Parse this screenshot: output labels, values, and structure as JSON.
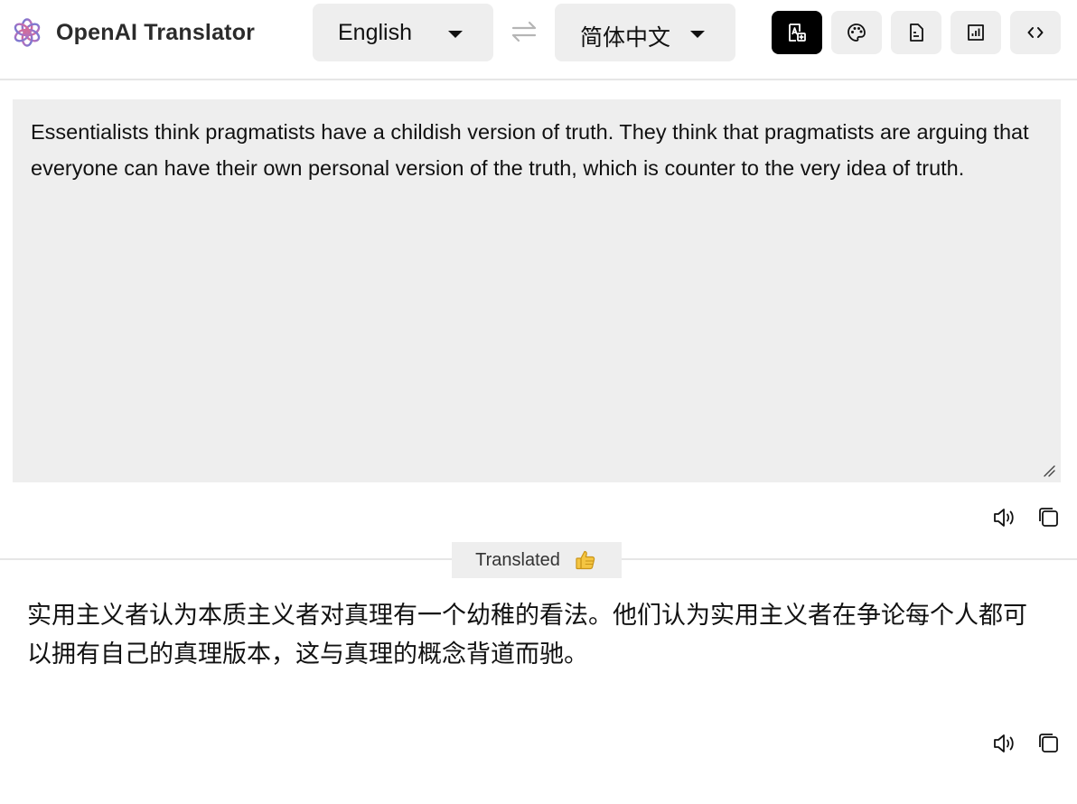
{
  "app": {
    "title": "OpenAI Translator"
  },
  "languages": {
    "source": "English",
    "target": "简体中文"
  },
  "toolbar": {
    "buttons": [
      {
        "name": "translate-mode-icon",
        "active": true
      },
      {
        "name": "palette-icon",
        "active": false
      },
      {
        "name": "document-icon",
        "active": false
      },
      {
        "name": "chart-icon",
        "active": false
      },
      {
        "name": "code-icon",
        "active": false
      }
    ]
  },
  "input": {
    "text": "Essentialists think pragmatists have a childish version of truth. They think that pragmatists are arguing that everyone can have their own personal version of the truth, which is counter to the very idea of truth."
  },
  "status": {
    "label": "Translated",
    "icon": "thumbs-up-icon"
  },
  "output": {
    "text": "实用主义者认为本质主义者对真理有一个幼稚的看法。他们认为实用主义者在争论每个人都可以拥有自己的真理版本，这与真理的概念背道而驰。"
  },
  "colors": {
    "panel": "#eeeeee",
    "active_button": "#000000",
    "divider": "#e6e6e6"
  }
}
